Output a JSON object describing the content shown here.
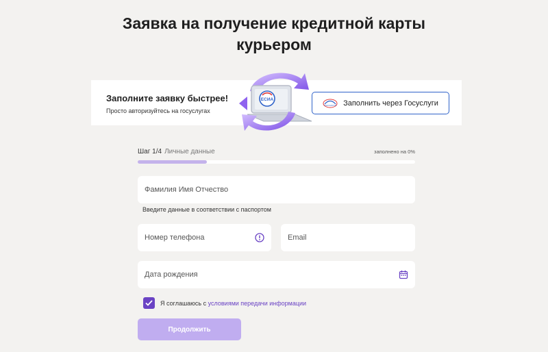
{
  "page": {
    "title": "Заявка на получение кредитной карты курьером"
  },
  "banner": {
    "title": "Заполните заявку быстрее!",
    "subtitle": "Просто авторизуйтесь на госуслугах",
    "illustration_label": "ЕСИА",
    "gosuslugi_button_label": "Заполнить через Госуслуги",
    "gosuslugi_icon_text": "ГОСУСЛУГИ"
  },
  "progress": {
    "step": "Шаг 1/4",
    "step_name": "Личные данные",
    "filled_label": "заполнено на 0%",
    "fill_fraction": 0.25
  },
  "form": {
    "fio_placeholder": "Фамилия Имя Отчество",
    "fio_hint": "Введите данные в соответствии с паспортом",
    "phone_placeholder": "Номер телефона",
    "email_placeholder": "Email",
    "birthdate_placeholder": "Дата рождения",
    "agree_prefix": "Я соглашаюсь с ",
    "agree_link": "условиями передачи информации",
    "agree_checked": true,
    "continue_label": "Продолжить"
  },
  "icons": {
    "phone_info": "info-circle-icon",
    "calendar": "calendar-icon",
    "check": "checkmark-icon"
  },
  "colors": {
    "background": "#f3f2f0",
    "accent": "#6a43c4",
    "button_disabled": "#c0adf0",
    "gosuslugi_border": "#2f62c9",
    "progress_fill": "#c4b3eb"
  }
}
